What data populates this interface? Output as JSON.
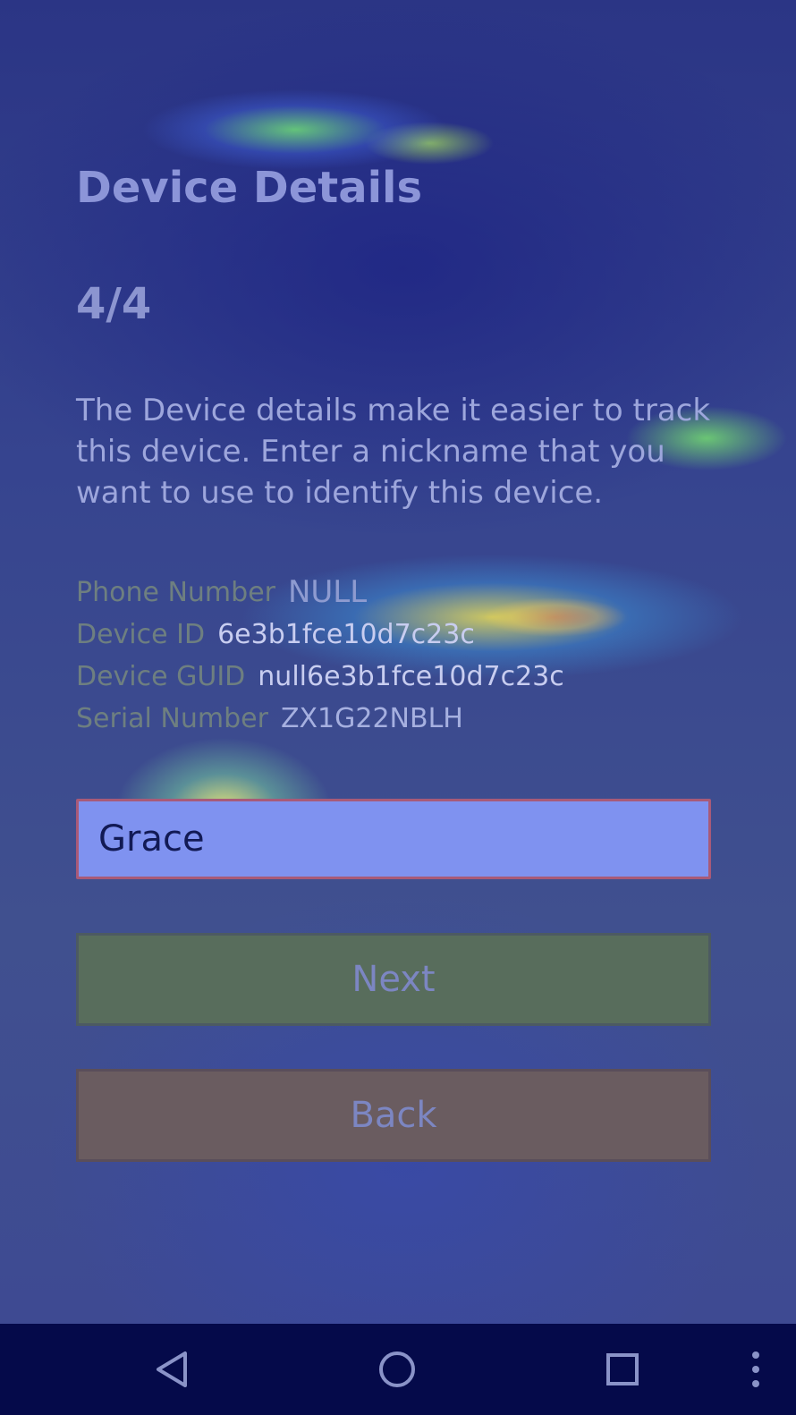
{
  "page": {
    "title": "Device Details",
    "step": "4/4",
    "description": "The Device details make it easier to track this device. Enter a nickname that you want to use to identify this device."
  },
  "info": {
    "phone_label": "Phone Number",
    "phone_value": "NULL",
    "device_id_label": "Device ID",
    "device_id_value": "6e3b1fce10d7c23c",
    "guid_label": "Device GUID",
    "guid_value": "null6e3b1fce10d7c23c",
    "serial_label": "Serial Number",
    "serial_value": "ZX1G22NBLH"
  },
  "nickname_input": {
    "value": "Grace"
  },
  "buttons": {
    "next": "Next",
    "back": "Back"
  },
  "navbar": {
    "icons": [
      "back-triangle-icon",
      "home-circle-icon",
      "recents-square-icon",
      "overflow-menu-icon"
    ]
  },
  "colors": {
    "next_button": "#586d5c",
    "back_button": "#6a5c60",
    "input_bg": "#7f92f0",
    "navbar_bg": "#050a4a"
  }
}
